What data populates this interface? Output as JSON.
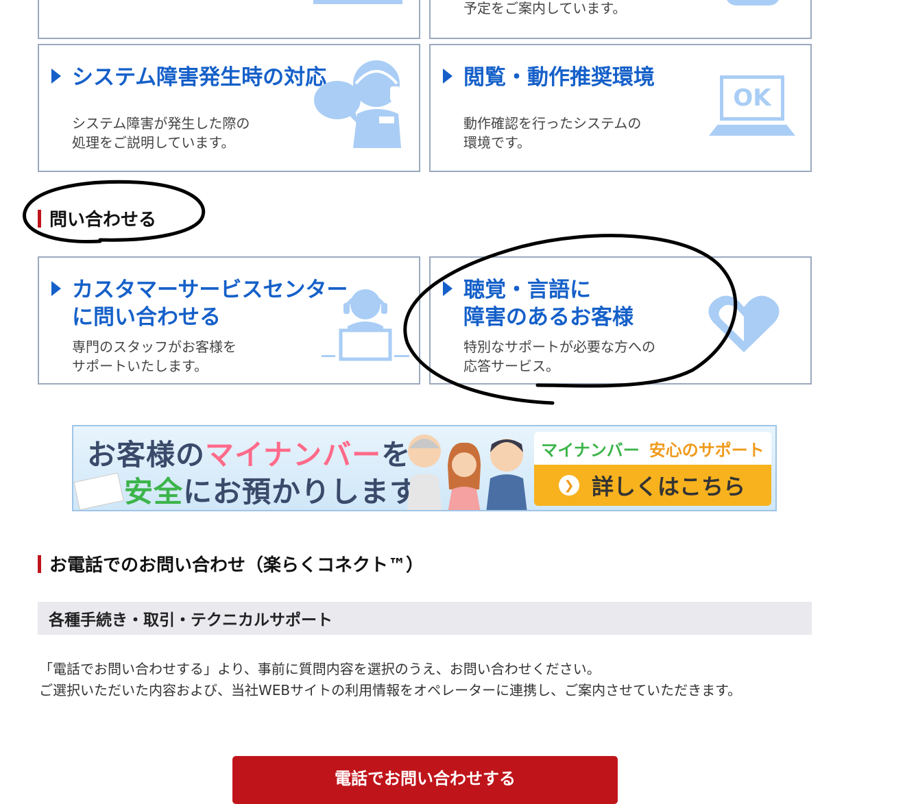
{
  "top_cards": [
    {
      "desc1": "",
      "desc2": "予定をご案内しています。"
    }
  ],
  "cards_row1": [
    {
      "title": "システム障害発生時の対応",
      "desc1": "システム障害が発生した際の",
      "desc2": "処理をご説明しています。",
      "icon": "operator-headset-icon"
    },
    {
      "title": "閲覧・動作推奨環境",
      "desc1": "動作確認を行ったシステムの",
      "desc2": "環境です。",
      "icon": "laptop-ok-icon",
      "icon_text": "OK"
    }
  ],
  "section_contact": {
    "title": "問い合わせる"
  },
  "cards_row2": [
    {
      "title1": "カスタマーサービスセンター",
      "title2": "に問い合わせる",
      "desc1": "専門のスタッフがお客様を",
      "desc2": "サポートいたします。",
      "icon": "support-agent-icon"
    },
    {
      "title1": "聴覚・言語に",
      "title2": "障害のあるお客様",
      "desc1": "特別なサポートが必要な方への",
      "desc2": "応答サービス。",
      "icon": "heart-icon"
    }
  ],
  "banner": {
    "line1_a": "お客様の",
    "line1_highlight": "マイナンバー",
    "line1_b": "を",
    "line2_highlight": "安全",
    "line2_b": "にお預かりします。",
    "right_top_a": "マイナンバー",
    "right_top_b": "安心のサポート",
    "right_button": "詳しくはこちら"
  },
  "section_phone": {
    "title": "お電話でのお問い合わせ（楽らくコネクト™）"
  },
  "grey_band": "各種手続き・取引・テクニカルサポート",
  "paragraph": {
    "line1": "「電話でお問い合わせする」より、事前に質問内容を選択のうえ、お問い合わせください。",
    "line2": "ご選択いただいた内容および、当社WEBサイトの利用情報をオペレーターに連携し、ご案内させていただきます。"
  },
  "call_button": "電話でお問い合わせする",
  "colors": {
    "link_blue": "#1560c9",
    "accent_red": "#c0141b",
    "icon_blue": "#a9cdf5"
  }
}
